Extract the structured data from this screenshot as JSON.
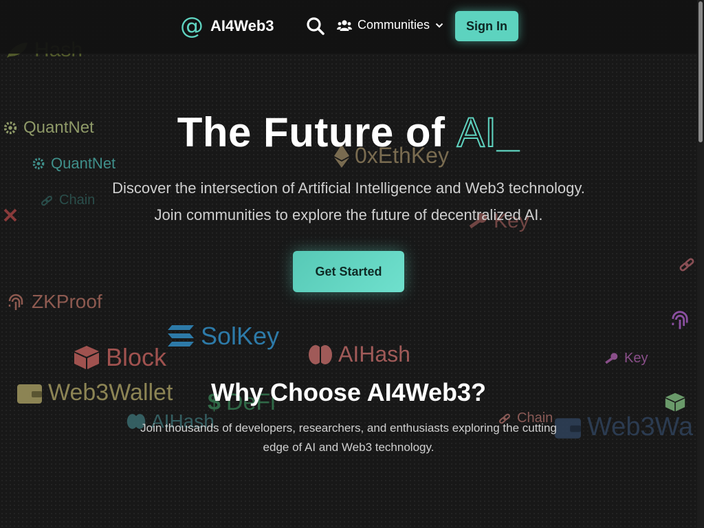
{
  "header": {
    "brand_symbol": "@",
    "brand_name": "AI4Web3",
    "search_icon": "search-icon",
    "communities_label": "Communities",
    "signin_label": "Sign In"
  },
  "hero": {
    "title_main": "The Future of ",
    "title_accent": "AI",
    "title_cursor": "_",
    "subtitle_line1": "Discover the intersection of Artificial Intelligence and Web3 technology.",
    "subtitle_line2": "Join communities to explore the future of decentralized AI.",
    "cta_label": "Get Started"
  },
  "why": {
    "title": "Why Choose AI4Web3?",
    "subtitle_line1": "Join thousands of developers, researchers, and enthusiasts exploring the cutting",
    "subtitle_line2": "edge of AI and Web3 technology."
  },
  "background_tokens": [
    {
      "label": "Hash",
      "icon": "leaf-icon",
      "color": "#7f8f3a"
    },
    {
      "label": "QuantNet",
      "icon": "gear-icon",
      "color": "#8f9a68"
    },
    {
      "label": "QuantNet",
      "icon": "gear-icon",
      "color": "#3f8f8a"
    },
    {
      "label": "Chain",
      "icon": "link-icon",
      "color": "#2e5b57"
    },
    {
      "label": "0xEthKey",
      "icon": "ethereum-icon",
      "color": "#8a7a5a"
    },
    {
      "label": "Key",
      "icon": "key-icon",
      "color": "#7a4a48"
    },
    {
      "label": "ZKProof",
      "icon": "fingerprint-icon",
      "color": "#8e5a50"
    },
    {
      "label": "SolKey",
      "icon": "solana-icon",
      "color": "#2d7aa8"
    },
    {
      "label": "Block",
      "icon": "cube-icon",
      "color": "#a0524f"
    },
    {
      "label": "AIHash",
      "icon": "brain-icon",
      "color": "#a05a58"
    },
    {
      "label": "Web3Wallet",
      "icon": "wallet-icon",
      "color": "#8c8454"
    },
    {
      "label": "DeFi",
      "icon": "dollar-icon",
      "color": "#3a8a5a"
    },
    {
      "label": "AIHash",
      "icon": "brain-icon",
      "color": "#3a6b6e"
    },
    {
      "label": "Chain",
      "icon": "link-icon",
      "color": "#8a5a56"
    },
    {
      "label": "Web3Wa",
      "icon": "wallet-icon",
      "color": "#2e3f57"
    },
    {
      "label": "Key",
      "icon": "key-icon",
      "color": "#8a4f8a"
    },
    {
      "label": "",
      "icon": "link-icon",
      "color": "#8a4f55"
    },
    {
      "label": "",
      "icon": "fingerprint-icon",
      "color": "#8a4fa0"
    },
    {
      "label": "",
      "icon": "cube-icon",
      "color": "#6a9a6a"
    },
    {
      "label": "",
      "icon": "x-icon",
      "color": "#8a3a3a"
    }
  ]
}
